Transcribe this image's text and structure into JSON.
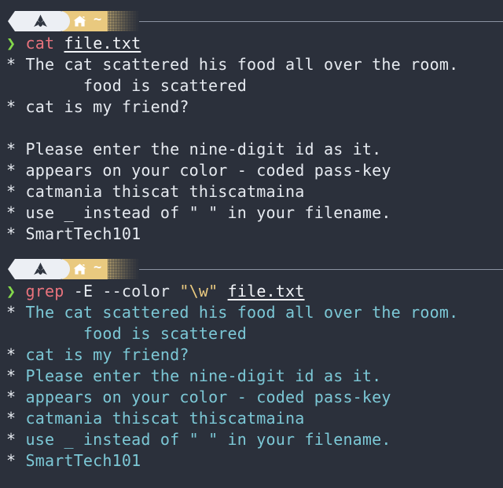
{
  "terminal": {
    "background_color": "#2b303b",
    "foreground_color": "#e6eaf0",
    "prompt_symbol": "❯",
    "bullet": "*"
  },
  "colors": {
    "prompt_green": "#84d94b",
    "command_red": "#e9737d",
    "string_yellow": "#e9c97f",
    "match_cyan": "#7cc8d6",
    "badge_os_bg": "#eceff4",
    "badge_path_bg": "#e9c97f",
    "rule_gray": "#8b93a1"
  },
  "blocks": [
    {
      "id": "block-cat",
      "badge": {
        "os_icon": "arch-linux-icon",
        "home_icon": "home-icon",
        "path": "~"
      },
      "command": {
        "prompt": "❯",
        "name": "cat",
        "args_plain": "",
        "string": "",
        "file": "file.txt"
      },
      "output": [
        {
          "bullet": "*",
          "text": " The cat scattered his food all over the room.",
          "color": "plain"
        },
        {
          "bullet": "",
          "text": "        food is scattered",
          "color": "plain"
        },
        {
          "bullet": "*",
          "text": " cat is my friend?",
          "color": "plain"
        },
        {
          "bullet": "",
          "text": "",
          "color": "plain"
        },
        {
          "bullet": "*",
          "text": " Please enter the nine-digit id as it.",
          "color": "plain"
        },
        {
          "bullet": "*",
          "text": " appears on your color - coded pass-key",
          "color": "plain"
        },
        {
          "bullet": "*",
          "text": " catmania thiscat thiscatmaina",
          "color": "plain"
        },
        {
          "bullet": "*",
          "text": " use _ instead of \" \" in your filename.",
          "color": "plain"
        },
        {
          "bullet": "*",
          "text": " SmartTech101",
          "color": "plain"
        }
      ]
    },
    {
      "id": "block-grep",
      "badge": {
        "os_icon": "arch-linux-icon",
        "home_icon": "home-icon",
        "path": "~"
      },
      "command": {
        "prompt": "❯",
        "name": "grep",
        "args_plain": " -E --color ",
        "string": "\"\\w\"",
        "file": "file.txt"
      },
      "output": [
        {
          "bullet": "*",
          "text": " The cat scattered his food all over the room.",
          "color": "cyan"
        },
        {
          "bullet": "",
          "text": "        food is scattered",
          "color": "cyan"
        },
        {
          "bullet": "*",
          "text": " cat is my friend?",
          "color": "cyan"
        },
        {
          "bullet": "*",
          "text": " Please enter the nine-digit id as it.",
          "color": "cyan"
        },
        {
          "bullet": "*",
          "text": " appears on your color - coded pass-key",
          "color": "cyan"
        },
        {
          "bullet": "*",
          "text": " catmania thiscat thiscatmaina",
          "color": "cyan"
        },
        {
          "bullet": "*",
          "text": " use _ instead of \" \" in your filename.",
          "color": "cyan"
        },
        {
          "bullet": "*",
          "text": " SmartTech101",
          "color": "cyan"
        }
      ]
    }
  ]
}
